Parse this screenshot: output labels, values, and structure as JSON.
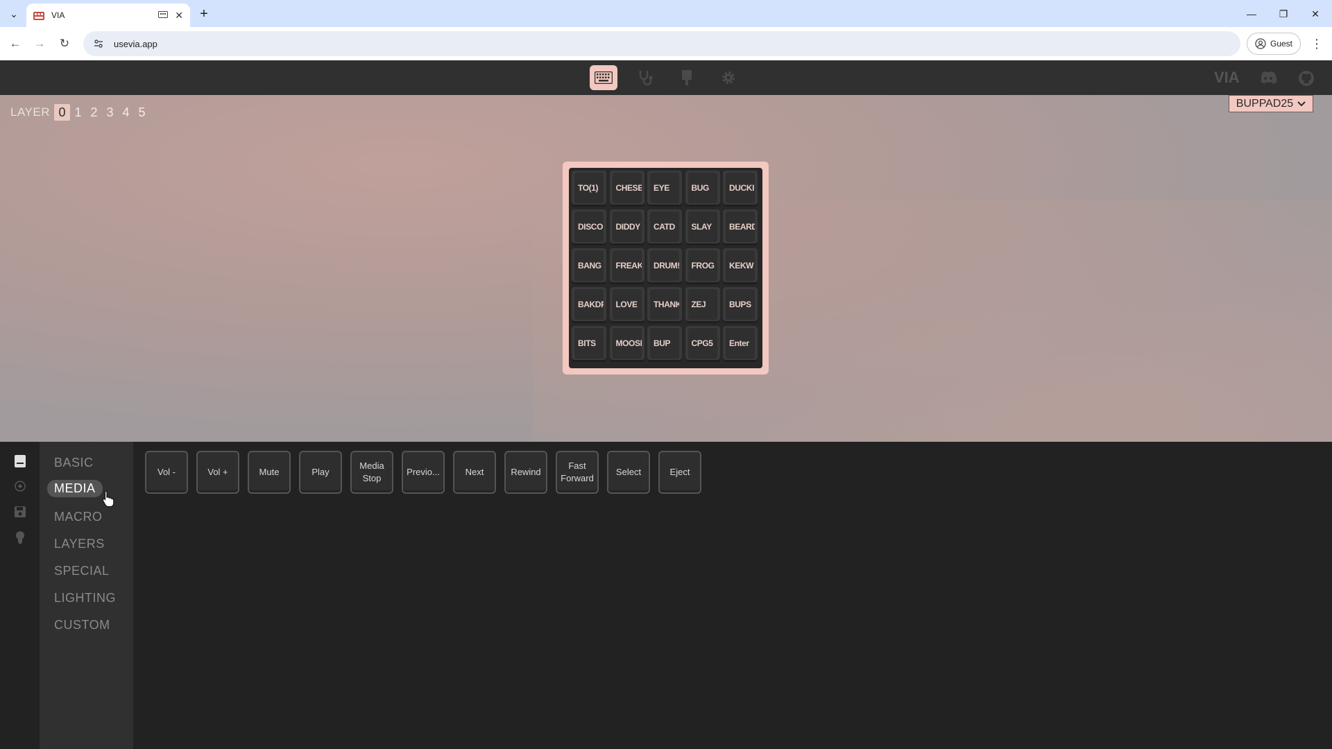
{
  "browser": {
    "tab_title": "VIA",
    "url": "usevia.app",
    "profile_label": "Guest"
  },
  "layers": {
    "label": "LAYER",
    "items": [
      "0",
      "1",
      "2",
      "3",
      "4",
      "5"
    ],
    "active": "0"
  },
  "keyboard_selector": {
    "value": "BUPPAD25"
  },
  "keymap": [
    [
      "TO(1)",
      "CHESE",
      "EYE",
      "BUG",
      "DUCKI"
    ],
    [
      "DISCO",
      "DIDDY",
      "CATD",
      "SLAY",
      "BEARD"
    ],
    [
      "BANG",
      "FREAK",
      "DRUM!",
      "FROG",
      "KEKW"
    ],
    [
      "BAKDR",
      "LOVE",
      "THANK",
      "ZEJ",
      "BUPS"
    ],
    [
      "BITS",
      "MOOSI",
      "BUP",
      "CPG5",
      "Enter"
    ]
  ],
  "header_right": {
    "logo_text": "VIA"
  },
  "menu": {
    "items": [
      "BASIC",
      "MEDIA",
      "MACRO",
      "LAYERS",
      "SPECIAL",
      "LIGHTING",
      "CUSTOM"
    ],
    "active": "MEDIA"
  },
  "media_keys": [
    {
      "line1": "Vol -",
      "line2": ""
    },
    {
      "line1": "Vol +",
      "line2": ""
    },
    {
      "line1": "Mute",
      "line2": ""
    },
    {
      "line1": "Play",
      "line2": ""
    },
    {
      "line1": "Media",
      "line2": "Stop"
    },
    {
      "line1": "Previo...",
      "line2": ""
    },
    {
      "line1": "Next",
      "line2": ""
    },
    {
      "line1": "Rewind",
      "line2": ""
    },
    {
      "line1": "Fast",
      "line2": "Forward"
    },
    {
      "line1": "Select",
      "line2": ""
    },
    {
      "line1": "Eject",
      "line2": ""
    }
  ]
}
